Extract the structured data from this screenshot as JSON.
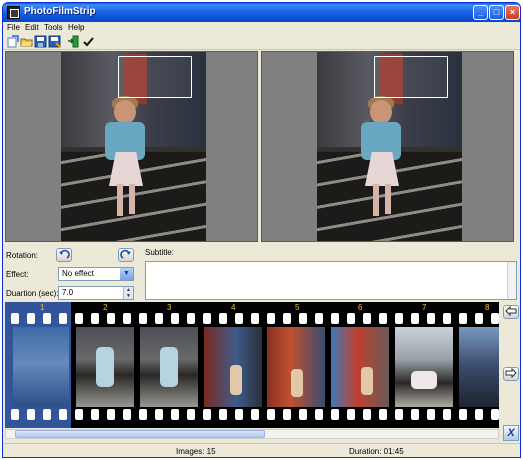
{
  "window": {
    "title": "PhotoFilmStrip"
  },
  "menu": [
    "File",
    "Edit",
    "Tools",
    "Help"
  ],
  "toolbar": [
    "new-project-icon",
    "open-icon",
    "save-icon",
    "save-as-icon",
    "import-icon",
    "render-check-icon"
  ],
  "controls": {
    "rotation_label": "Rotation:",
    "effect_label": "Effect:",
    "effect_value": "No effect",
    "duration_label": "Duartion (sec):",
    "duration_value": "7.0",
    "subtitle_label": "Subtitle:",
    "subtitle_value": ""
  },
  "filmstrip": {
    "frame_numbers": [
      "1",
      "2",
      "3",
      "4",
      "5",
      "6",
      "7",
      "8"
    ],
    "selected_index": 0
  },
  "status": {
    "images": "Images: 15",
    "duration": "Duration: 01:45"
  },
  "colors": {
    "titlebar": "#0b4fd3",
    "selection": "#4678dc",
    "film": "#000000",
    "frame_number": "#f0c040"
  }
}
